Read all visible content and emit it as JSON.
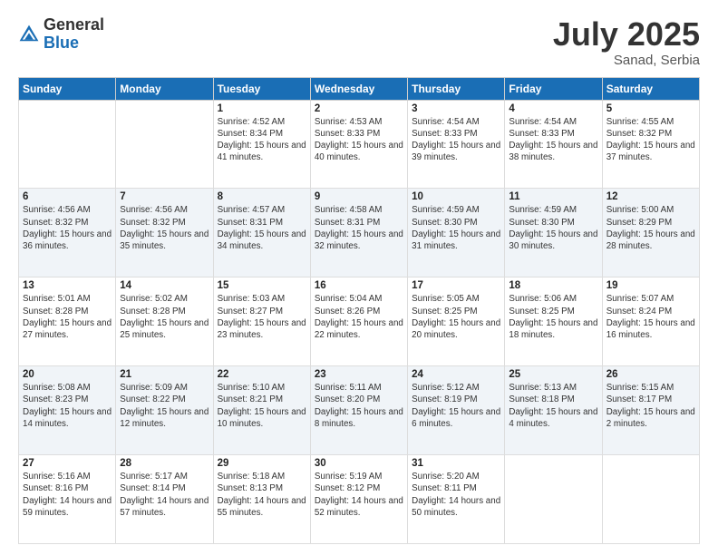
{
  "header": {
    "logo_general": "General",
    "logo_blue": "Blue",
    "month_year": "July 2025",
    "location": "Sanad, Serbia"
  },
  "weekdays": [
    "Sunday",
    "Monday",
    "Tuesday",
    "Wednesday",
    "Thursday",
    "Friday",
    "Saturday"
  ],
  "weeks": [
    [
      {
        "day": "",
        "info": ""
      },
      {
        "day": "",
        "info": ""
      },
      {
        "day": "1",
        "info": "Sunrise: 4:52 AM\nSunset: 8:34 PM\nDaylight: 15 hours and 41 minutes."
      },
      {
        "day": "2",
        "info": "Sunrise: 4:53 AM\nSunset: 8:33 PM\nDaylight: 15 hours and 40 minutes."
      },
      {
        "day": "3",
        "info": "Sunrise: 4:54 AM\nSunset: 8:33 PM\nDaylight: 15 hours and 39 minutes."
      },
      {
        "day": "4",
        "info": "Sunrise: 4:54 AM\nSunset: 8:33 PM\nDaylight: 15 hours and 38 minutes."
      },
      {
        "day": "5",
        "info": "Sunrise: 4:55 AM\nSunset: 8:32 PM\nDaylight: 15 hours and 37 minutes."
      }
    ],
    [
      {
        "day": "6",
        "info": "Sunrise: 4:56 AM\nSunset: 8:32 PM\nDaylight: 15 hours and 36 minutes."
      },
      {
        "day": "7",
        "info": "Sunrise: 4:56 AM\nSunset: 8:32 PM\nDaylight: 15 hours and 35 minutes."
      },
      {
        "day": "8",
        "info": "Sunrise: 4:57 AM\nSunset: 8:31 PM\nDaylight: 15 hours and 34 minutes."
      },
      {
        "day": "9",
        "info": "Sunrise: 4:58 AM\nSunset: 8:31 PM\nDaylight: 15 hours and 32 minutes."
      },
      {
        "day": "10",
        "info": "Sunrise: 4:59 AM\nSunset: 8:30 PM\nDaylight: 15 hours and 31 minutes."
      },
      {
        "day": "11",
        "info": "Sunrise: 4:59 AM\nSunset: 8:30 PM\nDaylight: 15 hours and 30 minutes."
      },
      {
        "day": "12",
        "info": "Sunrise: 5:00 AM\nSunset: 8:29 PM\nDaylight: 15 hours and 28 minutes."
      }
    ],
    [
      {
        "day": "13",
        "info": "Sunrise: 5:01 AM\nSunset: 8:28 PM\nDaylight: 15 hours and 27 minutes."
      },
      {
        "day": "14",
        "info": "Sunrise: 5:02 AM\nSunset: 8:28 PM\nDaylight: 15 hours and 25 minutes."
      },
      {
        "day": "15",
        "info": "Sunrise: 5:03 AM\nSunset: 8:27 PM\nDaylight: 15 hours and 23 minutes."
      },
      {
        "day": "16",
        "info": "Sunrise: 5:04 AM\nSunset: 8:26 PM\nDaylight: 15 hours and 22 minutes."
      },
      {
        "day": "17",
        "info": "Sunrise: 5:05 AM\nSunset: 8:25 PM\nDaylight: 15 hours and 20 minutes."
      },
      {
        "day": "18",
        "info": "Sunrise: 5:06 AM\nSunset: 8:25 PM\nDaylight: 15 hours and 18 minutes."
      },
      {
        "day": "19",
        "info": "Sunrise: 5:07 AM\nSunset: 8:24 PM\nDaylight: 15 hours and 16 minutes."
      }
    ],
    [
      {
        "day": "20",
        "info": "Sunrise: 5:08 AM\nSunset: 8:23 PM\nDaylight: 15 hours and 14 minutes."
      },
      {
        "day": "21",
        "info": "Sunrise: 5:09 AM\nSunset: 8:22 PM\nDaylight: 15 hours and 12 minutes."
      },
      {
        "day": "22",
        "info": "Sunrise: 5:10 AM\nSunset: 8:21 PM\nDaylight: 15 hours and 10 minutes."
      },
      {
        "day": "23",
        "info": "Sunrise: 5:11 AM\nSunset: 8:20 PM\nDaylight: 15 hours and 8 minutes."
      },
      {
        "day": "24",
        "info": "Sunrise: 5:12 AM\nSunset: 8:19 PM\nDaylight: 15 hours and 6 minutes."
      },
      {
        "day": "25",
        "info": "Sunrise: 5:13 AM\nSunset: 8:18 PM\nDaylight: 15 hours and 4 minutes."
      },
      {
        "day": "26",
        "info": "Sunrise: 5:15 AM\nSunset: 8:17 PM\nDaylight: 15 hours and 2 minutes."
      }
    ],
    [
      {
        "day": "27",
        "info": "Sunrise: 5:16 AM\nSunset: 8:16 PM\nDaylight: 14 hours and 59 minutes."
      },
      {
        "day": "28",
        "info": "Sunrise: 5:17 AM\nSunset: 8:14 PM\nDaylight: 14 hours and 57 minutes."
      },
      {
        "day": "29",
        "info": "Sunrise: 5:18 AM\nSunset: 8:13 PM\nDaylight: 14 hours and 55 minutes."
      },
      {
        "day": "30",
        "info": "Sunrise: 5:19 AM\nSunset: 8:12 PM\nDaylight: 14 hours and 52 minutes."
      },
      {
        "day": "31",
        "info": "Sunrise: 5:20 AM\nSunset: 8:11 PM\nDaylight: 14 hours and 50 minutes."
      },
      {
        "day": "",
        "info": ""
      },
      {
        "day": "",
        "info": ""
      }
    ]
  ]
}
